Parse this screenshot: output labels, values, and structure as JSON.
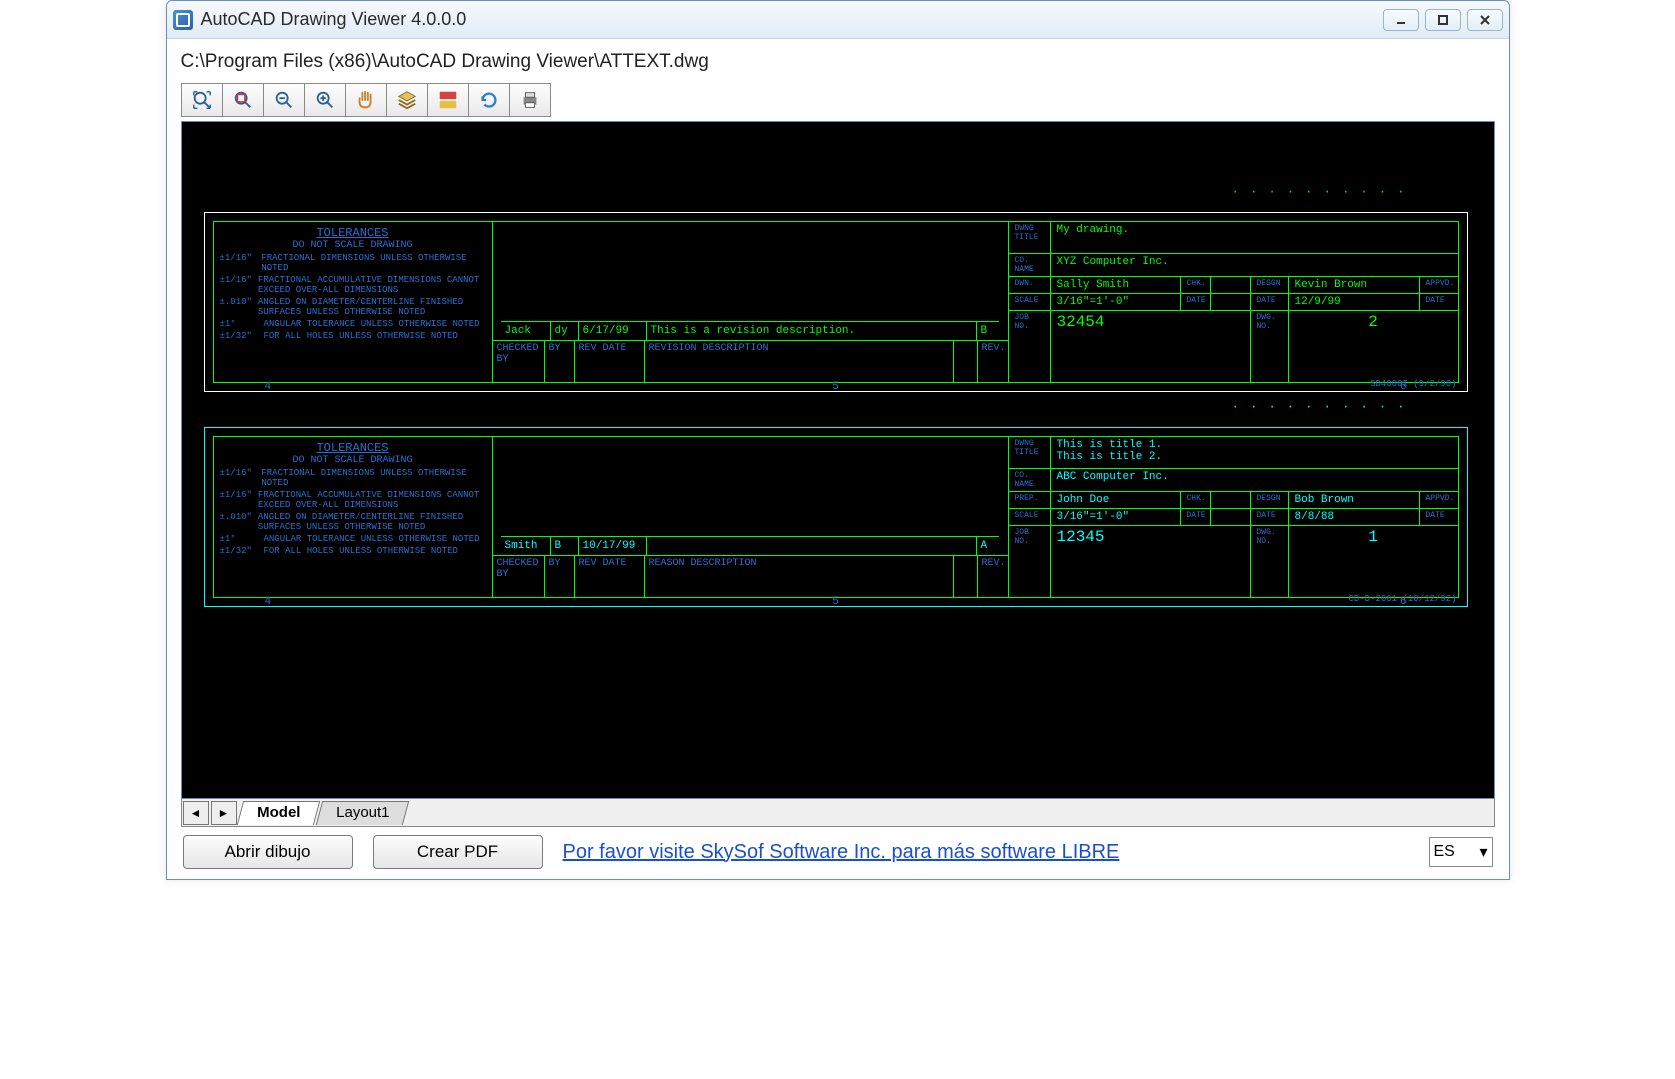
{
  "window": {
    "title": "AutoCAD Drawing Viewer 4.0.0.0"
  },
  "filepath": "C:\\Program Files (x86)\\AutoCAD Drawing Viewer\\ATTEXT.dwg",
  "toolbar": {
    "items": [
      "zoom-extents",
      "zoom-window",
      "zoom-out",
      "zoom-in",
      "pan",
      "layers",
      "background",
      "refresh",
      "print"
    ]
  },
  "drawing": {
    "block1": {
      "border": "white",
      "ruler": [
        "4",
        "5",
        "6"
      ],
      "stamp": "SD4000I (9/2/90)",
      "tolerances": {
        "heading": "TOLERANCES",
        "subheading": "DO NOT SCALE DRAWING",
        "rows": [
          {
            "lab": "±1/16\"",
            "txt": "FRACTIONAL DIMENSIONS UNLESS OTHERWISE NOTED"
          },
          {
            "lab": "±1/16\"",
            "txt": "FRACTIONAL ACCUMULATIVE DIMENSIONS CANNOT EXCEED OVER-ALL DIMENSIONS"
          },
          {
            "lab": "±.010\"",
            "txt": "ANGLED ON DIAMETER/CENTERLINE FINISHED SURFACES UNLESS OTHERWISE NOTED"
          },
          {
            "lab": "±1°",
            "txt": "ANGULAR TOLERANCE UNLESS OTHERWISE NOTED"
          },
          {
            "lab": "±1/32\"",
            "txt": "FOR ALL HOLES UNLESS OTHERWISE NOTED"
          }
        ]
      },
      "revision": {
        "checked": "CHECKED BY",
        "by": "Jack",
        "rev_by": "dy",
        "rev_date_label": "REV DATE",
        "rev_date": "6/17/99",
        "rev_desc_label": "REVISION DESCRIPTION",
        "rev_desc": "This is a revision description.",
        "letter": "B",
        "rev": "REV."
      },
      "titleblock": {
        "title_label": "DWNG TITLE",
        "title": "My drawing.",
        "company_label": "CO. NAME",
        "company": "XYZ Computer Inc.",
        "drawn_label": "DWN.",
        "drawn": "Sally Smith",
        "chk_label": "CHK.",
        "design_label": "DESGN",
        "design": "Kevin Brown",
        "appvd_label": "APPVD.",
        "scale_label": "SCALE",
        "scale": "3/16\"=1'-0\"",
        "date_label": "DATE",
        "date": "12/9/99",
        "job_label": "JOB NO.",
        "job": "32454",
        "dwg_label": "DWG. NO.",
        "dwg": "2"
      }
    },
    "block2": {
      "border": "cyan",
      "ruler": [
        "4",
        "5",
        "6"
      ],
      "stamp": "CD-D-2001 (10/12/92)",
      "tolerances": {
        "heading": "TOLERANCES",
        "subheading": "DO NOT SCALE DRAWING",
        "rows": [
          {
            "lab": "±1/16\"",
            "txt": "FRACTIONAL DIMENSIONS UNLESS OTHERWISE NOTED"
          },
          {
            "lab": "±1/16\"",
            "txt": "FRACTIONAL ACCUMULATIVE DIMENSIONS CANNOT EXCEED OVER-ALL DIMENSIONS"
          },
          {
            "lab": "±.010\"",
            "txt": "ANGLED ON DIAMETER/CENTERLINE FINISHED SURFACES UNLESS OTHERWISE NOTED"
          },
          {
            "lab": "±1°",
            "txt": "ANGULAR TOLERANCE UNLESS OTHERWISE NOTED"
          },
          {
            "lab": "±1/32\"",
            "txt": "FOR ALL HOLES UNLESS OTHERWISE NOTED"
          }
        ]
      },
      "revision": {
        "checked": "CHECKED BY",
        "by": "Smith",
        "rev_by": "B",
        "rev_date_label": "REV DATE",
        "rev_date": "10/17/99",
        "rev_desc_label": "REASON DESCRIPTION",
        "rev_desc": "",
        "letter": "A",
        "rev": "REV."
      },
      "titleblock": {
        "title_label": "DWNG TITLE",
        "title": "This is title 1.",
        "title2": "This is title 2.",
        "company_label": "CO. NAME",
        "company": "ABC Computer Inc.",
        "drawn_label": "PREP.",
        "drawn": "John Doe",
        "chk_label": "CHK.",
        "design_label": "DESGN",
        "design": "Bob Brown",
        "appvd_label": "APPVD.",
        "scale_label": "SCALE",
        "scale": "3/16\"=1'-0\"",
        "date_label": "DATE",
        "date": "8/8/88",
        "job_label": "JOB NO.",
        "job": "12345",
        "dwg_label": "DWG. NO.",
        "dwg": "1"
      }
    }
  },
  "tabs": {
    "model": "Model",
    "layout1": "Layout1"
  },
  "buttons": {
    "open": "Abrir dibujo",
    "pdf": "Crear PDF"
  },
  "link": "Por favor visite SkySof Software Inc. para más software LIBRE",
  "lang": "ES"
}
